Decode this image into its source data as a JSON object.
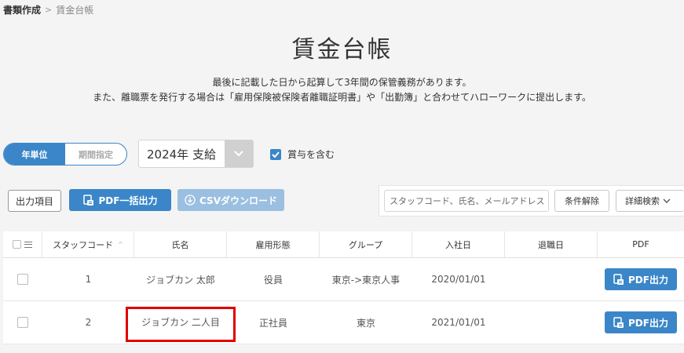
{
  "breadcrumb": {
    "parent": "書類作成",
    "separator": "＞",
    "current": "賃金台帳"
  },
  "page_title": "賃金台帳",
  "description": {
    "line1": "最後に記載した日から起算して3年間の保管義務があります。",
    "line2": "また、離職票を発行する場合は「雇用保険被保険者離職証明書」や「出勤簿」と合わせてハローワークに提出します。"
  },
  "period_toggle": {
    "options": [
      "年単位",
      "期間指定"
    ],
    "selected": "年単位"
  },
  "year_select": {
    "value": "2024年 支給"
  },
  "bonus_checkbox": {
    "label": "賞与を含む",
    "checked": true
  },
  "toolbar": {
    "output_items": "出力項目",
    "pdf_bulk": "PDF一括出力",
    "csv_download": "CSVダウンロード"
  },
  "search": {
    "placeholder": "スタッフコード、氏名、メールアドレス",
    "clear_label": "条件解除",
    "detail_label": "詳細検索"
  },
  "table": {
    "headers": [
      "スタッフコード",
      "氏名",
      "雇用形態",
      "グループ",
      "入社日",
      "退職日",
      "PDF"
    ],
    "sort_indicator": "^",
    "rows": [
      {
        "code": "1",
        "name": "ジョブカン 太郎",
        "employment": "役員",
        "group": "東京->東京人事",
        "hire_date": "2020/01/01",
        "leave_date": "",
        "pdf_label": "PDF出力"
      },
      {
        "code": "2",
        "name": "ジョブカン 二人目",
        "employment": "正社員",
        "group": "東京",
        "hire_date": "2021/01/01",
        "leave_date": "",
        "pdf_label": "PDF出力"
      }
    ]
  },
  "colors": {
    "accent": "#3a86c8",
    "accent_disabled": "#9bbfe0",
    "highlight": "#e00000"
  },
  "icons": [
    "chevron-down-icon",
    "checkmark-icon",
    "pdf-icon",
    "download-circle-icon",
    "list-icon"
  ]
}
